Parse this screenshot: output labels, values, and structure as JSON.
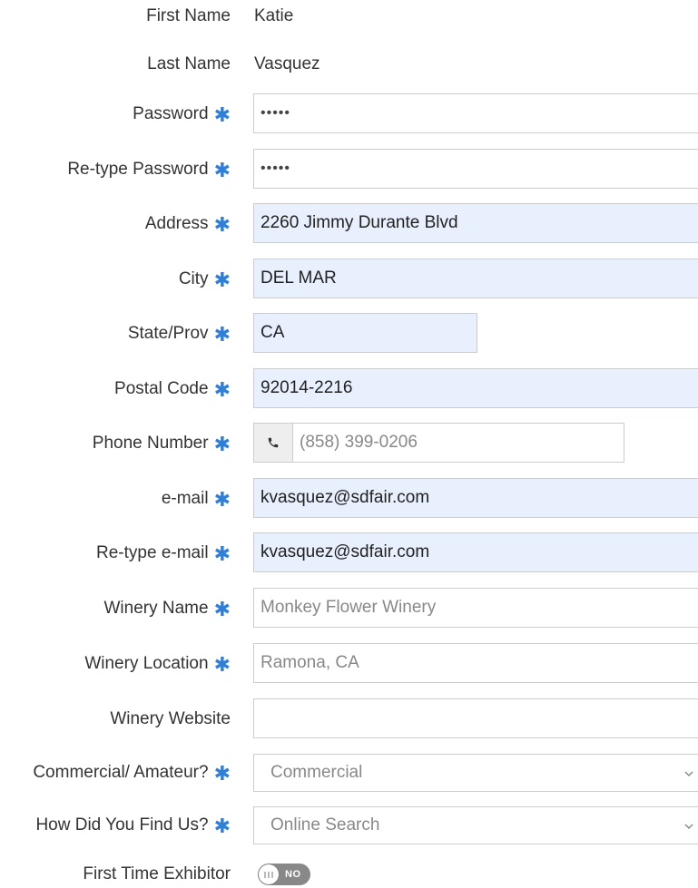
{
  "colors": {
    "required_star": "#2f7fd8",
    "autofill_background": "#e8f0fe",
    "input_border": "#cccccc",
    "toggle_background": "#888888"
  },
  "fields": {
    "first_name": {
      "label": "First Name",
      "value": "Katie"
    },
    "last_name": {
      "label": "Last Name",
      "value": "Vasquez"
    },
    "password": {
      "label": "Password",
      "value": "•••••"
    },
    "retype_password": {
      "label": "Re-type Password",
      "value": "•••••"
    },
    "address": {
      "label": "Address",
      "value": "2260 Jimmy Durante Blvd"
    },
    "city": {
      "label": "City",
      "value": "DEL MAR"
    },
    "state": {
      "label": "State/Prov",
      "value": "CA"
    },
    "postal_code": {
      "label": "Postal Code",
      "value": "92014-2216"
    },
    "phone": {
      "label": "Phone Number",
      "placeholder": "(858) 399-0206",
      "addon_icon": "phone-icon"
    },
    "email": {
      "label": "e-mail",
      "value": "kvasquez@sdfair.com"
    },
    "retype_email": {
      "label": "Re-type e-mail",
      "value": "kvasquez@sdfair.com"
    },
    "winery_name": {
      "label": "Winery Name",
      "placeholder": "Monkey Flower Winery"
    },
    "winery_location": {
      "label": "Winery Location",
      "placeholder": "Ramona, CA"
    },
    "winery_website": {
      "label": "Winery Website",
      "value": ""
    },
    "commercial_amateur": {
      "label": "Commercial/ Amateur?",
      "selected": "Commercial"
    },
    "how_found": {
      "label": "How Did You Find Us?",
      "selected": "Online Search"
    },
    "first_time_exhibitor": {
      "label": "First Time Exhibitor",
      "toggle_text": "NO"
    }
  },
  "required_marker": "✱"
}
